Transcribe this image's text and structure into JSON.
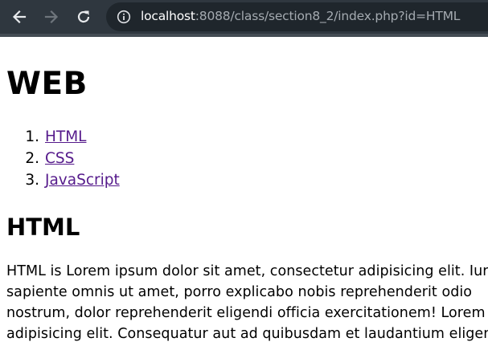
{
  "browser": {
    "url_host": "localhost",
    "url_rest": ":8088/class/section8_2/index.php?id=HTML",
    "icons": [
      "back-icon",
      "forward-icon",
      "reload-icon",
      "info-icon"
    ]
  },
  "page": {
    "title": "WEB",
    "topics": [
      {
        "number": "1.",
        "label": "HTML"
      },
      {
        "number": "2.",
        "label": "CSS"
      },
      {
        "number": "3.",
        "label": "JavaScript"
      }
    ],
    "section_title": "HTML",
    "body_lines": [
      "HTML is Lorem ipsum dolor sit amet, consectetur adipisicing elit. Iure",
      "sapiente omnis ut amet, porro explicabo nobis reprehenderit odio",
      "nostrum, dolor reprehenderit eligendi officia exercitationem! Lorem",
      "adipisicing elit. Consequatur aut ad quibusdam et laudantium eligendi"
    ]
  },
  "colors": {
    "toolbar": "#2f373f",
    "omnibox": "#1f262c",
    "visited_link": "#551a8b"
  }
}
